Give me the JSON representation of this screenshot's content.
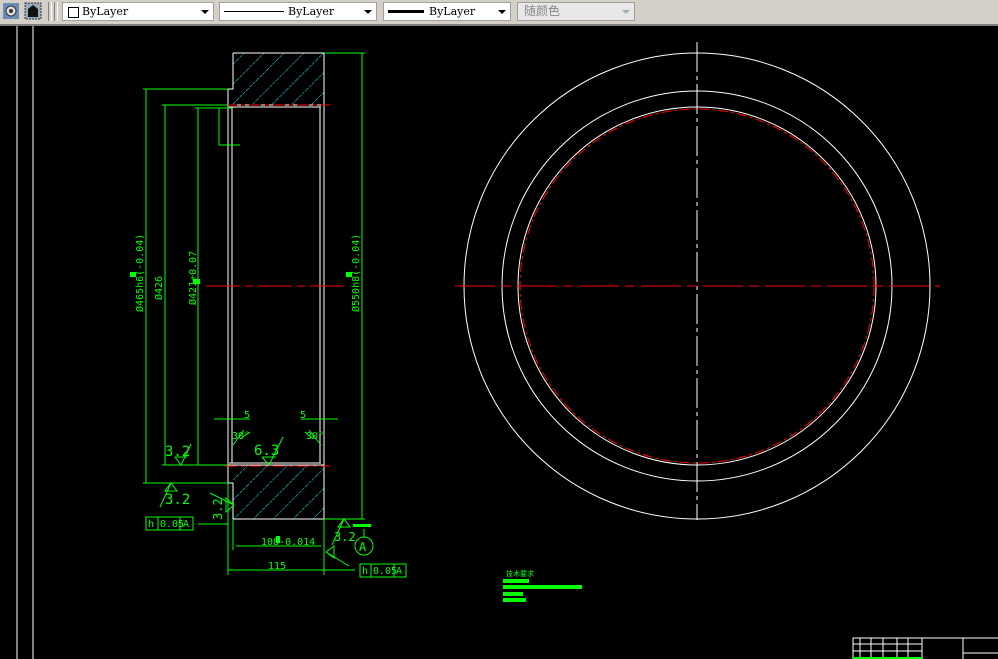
{
  "toolbar": {
    "icons": [
      "layer-settings-icon",
      "layer-previous-icon"
    ],
    "color_combo": "ByLayer",
    "linetype_combo": "ByLayer",
    "lineweight_combo": "ByLayer",
    "plotstyle_combo": "随颜色"
  },
  "drawing": {
    "dims": {
      "d465": "Ø465h6(-0.04)",
      "d426": "Ø426",
      "d421": "Ø421+0.07",
      "d550": "Ø550h8(-0.04)",
      "chamfer_left": "5",
      "chamfer_right": "5",
      "angle_left": "30°",
      "angle_right": "30°",
      "rough_63": "6.3",
      "rough_32_a": "3.2",
      "rough_32_b": "3.2",
      "rough_32_c": "3.2",
      "rough_32_d": "3.2",
      "len_108": "108-0.014",
      "len_115": "115",
      "datum": "A"
    },
    "tolerance_left": {
      "symbol": "h",
      "value": "0.05",
      "datum": "A"
    },
    "tolerance_right": {
      "symbol": "h",
      "value": "0.05",
      "datum": "A"
    },
    "notes_title": "技术要求"
  },
  "colors": {
    "dim": "#00ff00",
    "outline": "#ffffff",
    "hatch": "#00ffff",
    "center": "#ff0000"
  }
}
